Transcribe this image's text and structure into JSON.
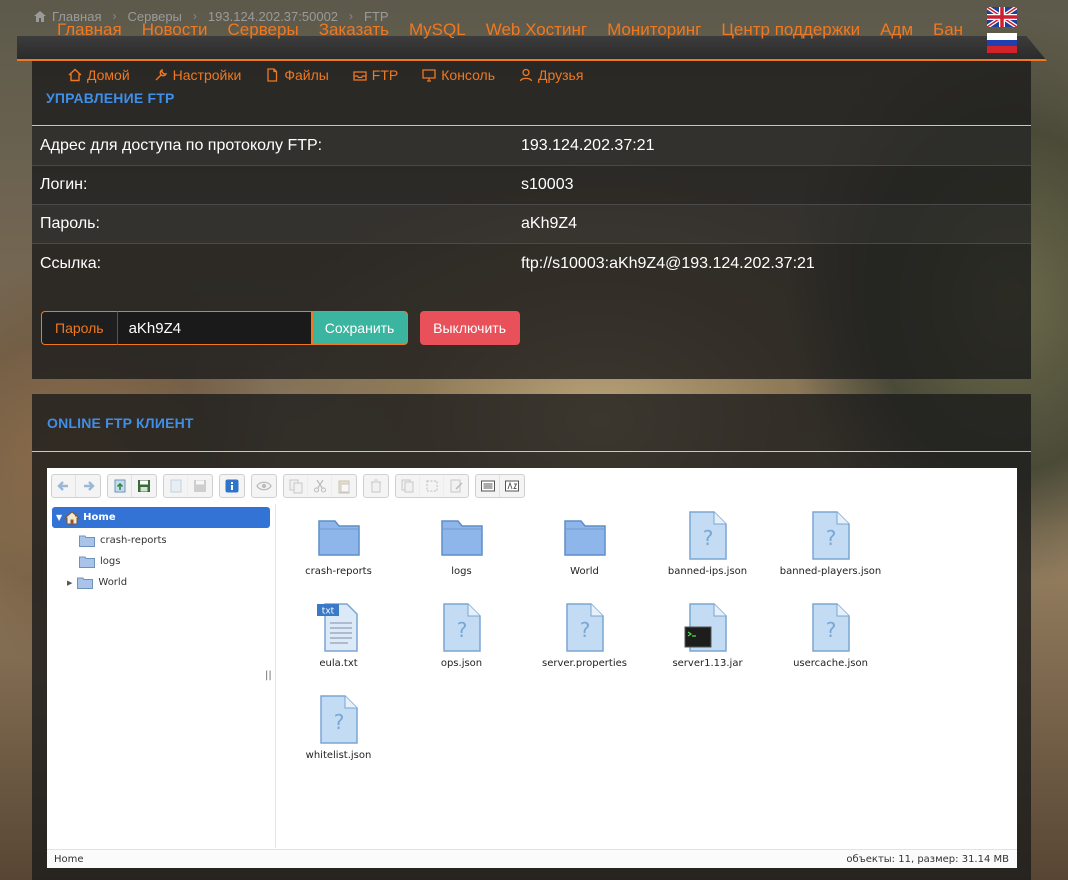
{
  "breadcrumb": [
    "Главная",
    "Серверы",
    "193.124.202.37:50002",
    "FTP"
  ],
  "nav": [
    "Главная",
    "Новости",
    "Серверы",
    "Заказать",
    "MySQL",
    "Web Хостинг",
    "Мониторинг",
    "Центр поддержки",
    "Адм",
    "Бан"
  ],
  "subnav": [
    {
      "label": "Домой",
      "icon": "home-icon"
    },
    {
      "label": "Настройки",
      "icon": "wrench-icon"
    },
    {
      "label": "Файлы",
      "icon": "file-icon"
    },
    {
      "label": "FTP",
      "icon": "inbox-icon"
    },
    {
      "label": "Консоль",
      "icon": "monitor-icon"
    },
    {
      "label": "Друзья",
      "icon": "user-icon"
    }
  ],
  "ftp_panel": {
    "title": "УПРАВЛЕНИЕ FTP",
    "rows": [
      {
        "key": "Адрес для доступа по протоколу FTP:",
        "value": "193.124.202.37:21"
      },
      {
        "key": "Логин:",
        "value": "s10003"
      },
      {
        "key": "Пароль:",
        "value": "aKh9Z4"
      },
      {
        "key": "Ссылка:",
        "value": "ftp://s10003:aKh9Z4@193.124.202.37:21"
      }
    ],
    "password_label": "Пароль",
    "password_value": "aKh9Z4",
    "save_label": "Сохранить",
    "disable_label": "Выключить"
  },
  "client_panel": {
    "title": "ONLINE FTP КЛИЕНТ",
    "tree": {
      "home": "Home",
      "items": [
        "crash-reports",
        "logs",
        "World"
      ]
    },
    "files": [
      {
        "name": "crash-reports",
        "type": "folder"
      },
      {
        "name": "logs",
        "type": "folder"
      },
      {
        "name": "World",
        "type": "folder"
      },
      {
        "name": "banned-ips.json",
        "type": "unknown"
      },
      {
        "name": "banned-players.json",
        "type": "unknown"
      },
      {
        "name": "eula.txt",
        "type": "txt",
        "badge": "txt"
      },
      {
        "name": "ops.json",
        "type": "unknown"
      },
      {
        "name": "server.properties",
        "type": "unknown"
      },
      {
        "name": "server1.13.jar",
        "type": "exec"
      },
      {
        "name": "usercache.json",
        "type": "unknown"
      },
      {
        "name": "whitelist.json",
        "type": "unknown"
      }
    ],
    "status_left": "Home",
    "status_right": "объекты: 11, размер: 31.14 MB"
  },
  "colors": {
    "accent": "#f07820",
    "title_blue": "#3f8ee8",
    "save": "#3bb5a0",
    "disable": "#e8505a",
    "selection": "#3473d6"
  }
}
